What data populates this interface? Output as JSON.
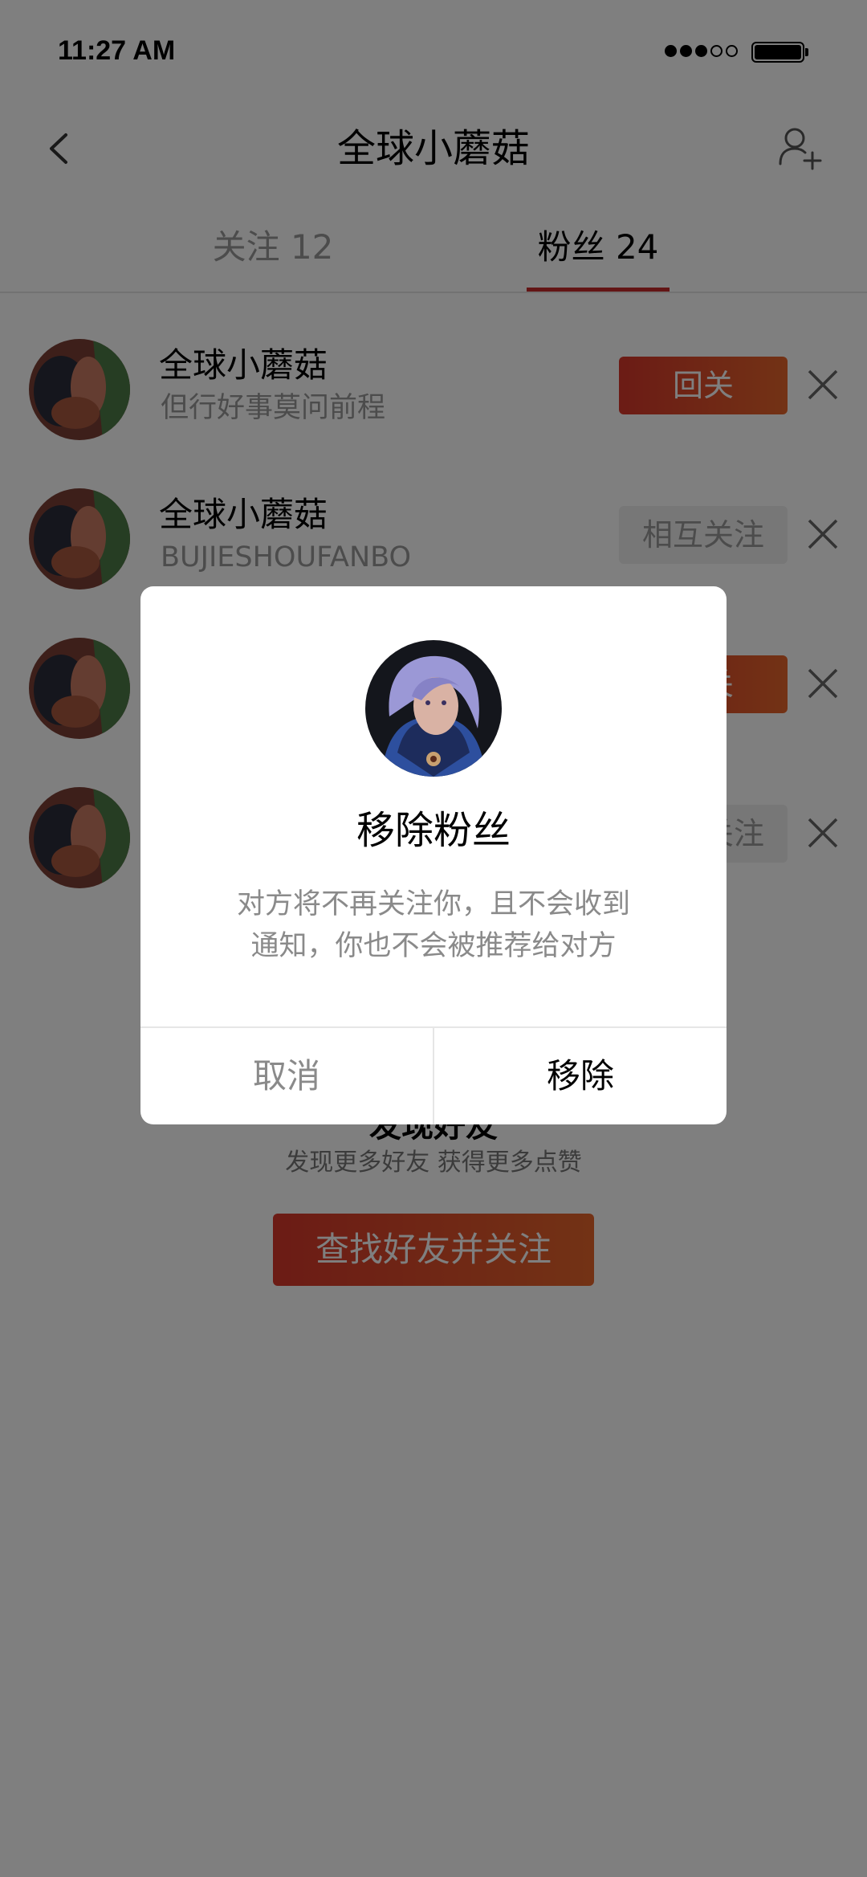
{
  "status_bar": {
    "time": "11:27 AM"
  },
  "nav": {
    "title": "全球小蘑菇"
  },
  "tabs": [
    {
      "label": "关注 12",
      "active": false
    },
    {
      "label": "粉丝 24",
      "active": true
    }
  ],
  "fans": [
    {
      "name": "全球小蘑菇",
      "subtitle": "但行好事莫问前程",
      "button": "回关",
      "button_style": "red"
    },
    {
      "name": "全球小蘑菇",
      "subtitle": "BUJIESHOUFANBO",
      "button": "相互关注",
      "button_style": "gray"
    },
    {
      "name": "",
      "subtitle": "",
      "button": "回关",
      "button_style": "red"
    },
    {
      "name": "",
      "subtitle": "",
      "button": "相互关注",
      "button_style": "gray"
    }
  ],
  "empty_state": {
    "title": "发现好友",
    "subtitle": "发现更多好友 获得更多点赞",
    "button": "查找好友并关注"
  },
  "dialog": {
    "title": "移除粉丝",
    "message_line1": "对方将不再关注你，且不会收到",
    "message_line2": "通知，你也不会被推荐给对方",
    "cancel": "取消",
    "confirm": "移除"
  },
  "colors": {
    "accent": "#d8372a",
    "accent_end": "#e6652b",
    "tab_indicator": "#c62a2a",
    "overlay": "rgba(0,0,0,0.5)"
  }
}
